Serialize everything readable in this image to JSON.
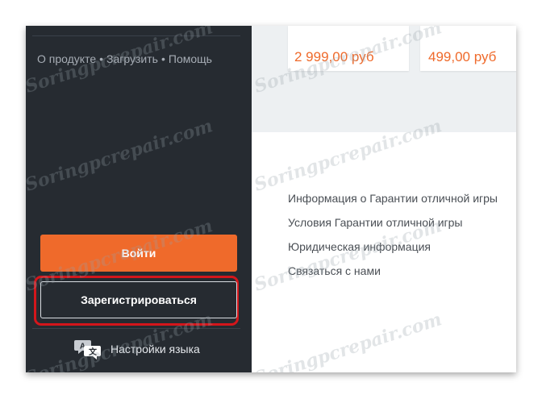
{
  "sidebar": {
    "links": [
      "О продукте",
      "Загрузить",
      "Помощь"
    ],
    "login_label": "Войти",
    "register_label": "Зарегистрироваться",
    "language_label": "Настройки языка",
    "language_icon": "translate-icon"
  },
  "prices": [
    "2 999,00 руб",
    "499,00 руб"
  ],
  "footer": {
    "links": [
      "Информация о Гарантии отличной игры",
      "Условия Гарантии отличной игры",
      "Юридическая информация",
      "Связаться с нами"
    ]
  },
  "watermark": "Soringpcrepair.com",
  "colors": {
    "sidebar_bg": "#262b31",
    "accent_orange": "#ef6a2b",
    "highlight_red": "#d4161b",
    "band_gray": "#edf0f2"
  }
}
